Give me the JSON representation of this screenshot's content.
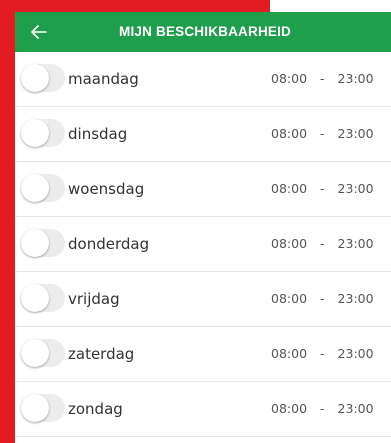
{
  "header": {
    "title": "MIJN BESCHIKBAARHEID",
    "back_icon": "arrow-left-icon"
  },
  "colors": {
    "header_bg": "#1f9e4b",
    "accent_red": "#e31b23",
    "toggle_off": "#ececec"
  },
  "days": [
    {
      "label": "maandag",
      "from": "08:00",
      "sep": "-",
      "to": "23:00",
      "enabled": false
    },
    {
      "label": "dinsdag",
      "from": "08:00",
      "sep": "-",
      "to": "23:00",
      "enabled": false
    },
    {
      "label": "woensdag",
      "from": "08:00",
      "sep": "-",
      "to": "23:00",
      "enabled": false
    },
    {
      "label": "donderdag",
      "from": "08:00",
      "sep": "-",
      "to": "23:00",
      "enabled": false
    },
    {
      "label": "vrijdag",
      "from": "08:00",
      "sep": "-",
      "to": "23:00",
      "enabled": false
    },
    {
      "label": "zaterdag",
      "from": "08:00",
      "sep": "-",
      "to": "23:00",
      "enabled": false
    },
    {
      "label": "zondag",
      "from": "08:00",
      "sep": "-",
      "to": "23:00",
      "enabled": false
    }
  ]
}
